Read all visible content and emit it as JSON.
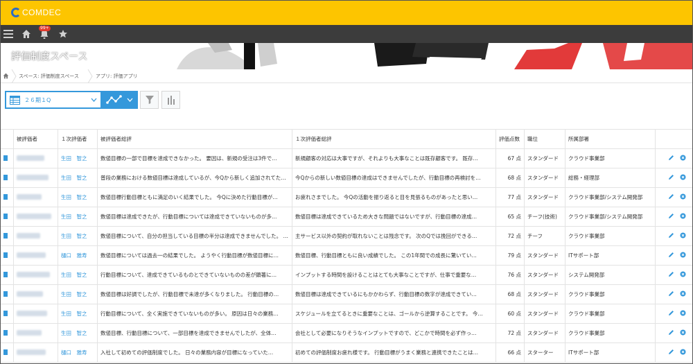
{
  "brand": {
    "name": "COMDEC"
  },
  "nav": {
    "notification_count": "99+"
  },
  "space": {
    "title": "評価制度スペース"
  },
  "breadcrumb": {
    "space": "スペース: 評価制度スペース",
    "app": "アプリ: 評価アプリ"
  },
  "view": {
    "selected": "２６期１Q"
  },
  "colors": {
    "topbar": "#fdc500",
    "navbar": "#3c3c3c",
    "accent": "#3498db"
  },
  "icons": {
    "menu": "menu-icon",
    "home": "home-icon",
    "bell": "bell-icon",
    "star": "star-icon",
    "breadcrumb_home": "home-icon",
    "view": "table-view-icon",
    "graph": "graph-icon",
    "filter": "filter-icon",
    "chart": "bar-chart-icon",
    "record": "document-icon",
    "edit": "pencil-icon",
    "delete": "remove-icon"
  },
  "table": {
    "headers": [
      "被評価者",
      "１次評価者",
      "被評価者総評",
      "１次評価者総評",
      "評価点数",
      "職位",
      "所属部署"
    ],
    "rows": [
      {
        "evaluator": "生田　智之",
        "self": "数値目標の一部で目標を達成できなかった。 要因は、新規の受注は3件で…",
        "review": "新規顧客の対応は大事ですが、それよりも大事なことは既存顧客です。 既存…",
        "score": "67 点",
        "position": "スタンダード",
        "dept": "クラウド事業部"
      },
      {
        "evaluator": "生田　智之",
        "self": "普段の業務における数値目標は達成しているが、今Qから新しく追加されてた…",
        "review": "今Qからの新しい数値目標の達成はできませんでしたが、行動目標の再検討を…",
        "score": "68 点",
        "position": "スタンダード",
        "dept": "総務・経理部"
      },
      {
        "evaluator": "生田　智之",
        "self": "数値目標行動目標ともに満足のいく結果でした。 今Qに決めた行動目標が…",
        "review": "お疲れさまでした。 今Qの活動を振り返ると目を見張るものがあったと思い…",
        "score": "77 点",
        "position": "スタンダード",
        "dept": "クラウド事業部/システム開発部"
      },
      {
        "evaluator": "生田　智之",
        "self": "数値目標は達成できたが、行動目標については達成できていないものが多…",
        "review": "数値目標は達成できているため大きな問題ではないですが、行動目標の達成…",
        "score": "65 点",
        "position": "チーフ(技術)",
        "dept": "クラウド事業部/システム開発部"
      },
      {
        "evaluator": "生田　智之",
        "self": "数値目標について、自分の担当している目標の半分は達成できませんでした。 も…",
        "review": "主サービス以外の契約が取れないことは残念です。 次のQでは挽回ができる…",
        "score": "72 点",
        "position": "チーフ",
        "dept": "クラウド事業部"
      },
      {
        "evaluator": "樋口　雅寿",
        "self": "数値目標については過去一の結果でした。 ようやく行動目標が数値目標に…",
        "review": "数値目標、行動目標ともに良い成績でした。 この1年間での成長に驚いてい…",
        "score": "79 点",
        "position": "スタンダード",
        "dept": "ITサポート部"
      },
      {
        "evaluator": "生田　智之",
        "self": "行動目標について、達成できているものとできていないものの差が顕著に…",
        "review": "インプットする時間を設けることはとても大事なことですが、仕事で重要な…",
        "score": "76 点",
        "position": "スタンダード",
        "dept": "システム開発部"
      },
      {
        "evaluator": "生田　智之",
        "self": "数値目標は好調でしたが、行動目標で未達が多くなりました。 行動目標の…",
        "review": "数値目標は達成できているにもかかわらず、行動目標の数字が達成できてい…",
        "score": "68 点",
        "position": "スタンダード",
        "dept": "クラウド事業部"
      },
      {
        "evaluator": "生田　智之",
        "self": "行動目標について、全く実施できていないものが多い。 原因は日々の業務…",
        "review": "スケジュールを立てるときに重要なことは、ゴールから逆算することです。 今…",
        "score": "60 点",
        "position": "スタンダード",
        "dept": "クラウド事業部"
      },
      {
        "evaluator": "生田　智之",
        "self": "数値目標、行動目標について、一部目標を達成できませんでしたが、全体…",
        "review": "会社として必要になりそうなインプットですので、どこかで時間を必ず作っ…",
        "score": "72 点",
        "position": "スタンダード",
        "dept": "クラウド事業部"
      },
      {
        "evaluator": "樋口　雅寿",
        "self": "入社して初めての評価制度でした。 日々の業務内容が目標になっていた…",
        "review": "初めての評価制度お疲れ様です。 行動目標がうまく業務と連携できたことは…",
        "score": "66 点",
        "position": "スターター",
        "dept": "ITサポート部"
      }
    ]
  }
}
